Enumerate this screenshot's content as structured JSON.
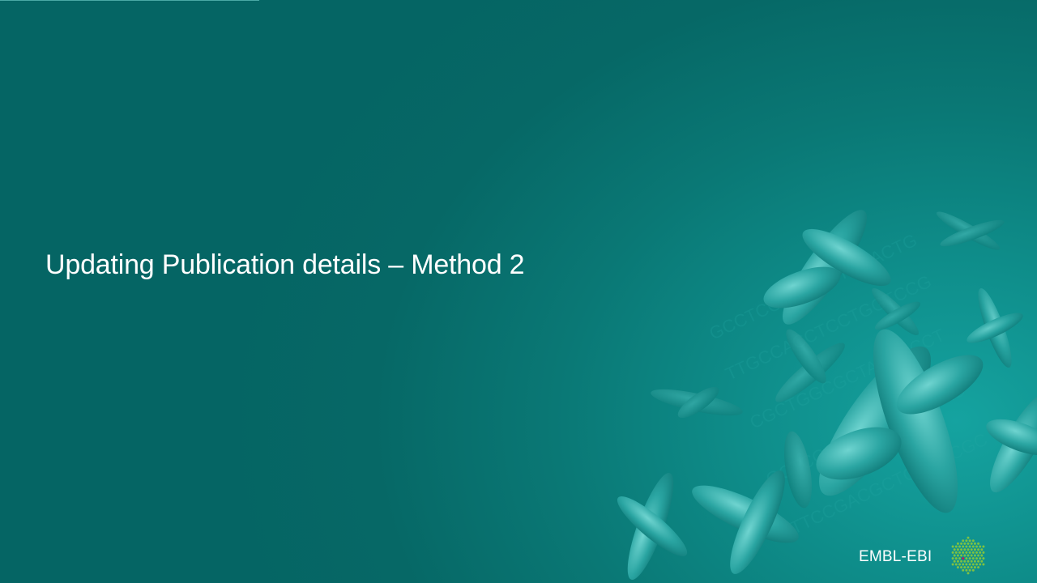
{
  "slide": {
    "title": "Updating Publication details – Method 2",
    "background_color": "#056564",
    "accent_color": "#15a3a0",
    "illustration": "chromosomes-on-dna-background"
  },
  "logo": {
    "text": "EMBL-EBI",
    "icon": "embl-ebi-hexagon-dots-icon",
    "dot_color": "#7ec242",
    "highlight_color": "#c2185b"
  }
}
